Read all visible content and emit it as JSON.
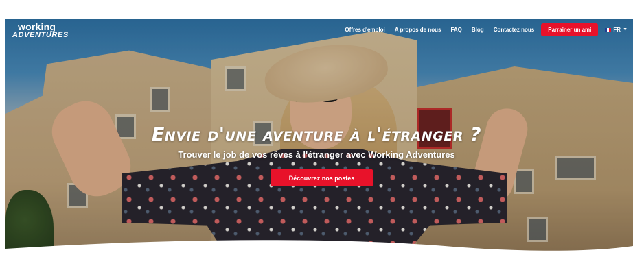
{
  "logo": {
    "line1": "working",
    "line2": "ADVENTURES"
  },
  "nav": {
    "items": [
      {
        "label": "Offres d'emploi"
      },
      {
        "label": "A propos de nous"
      },
      {
        "label": "FAQ"
      },
      {
        "label": "Blog"
      },
      {
        "label": "Contactez nous"
      }
    ],
    "refer_button": "Parrainer un ami",
    "language": "FR",
    "language_icon": "flag-fr-icon",
    "caret_icon": "chevron-down-icon"
  },
  "hero": {
    "headline": "Envie d'une aventure à l'étranger ?",
    "subline": "Trouver le job de vos rêves à l'étranger avec Working Adventures",
    "cta": "Découvrez nos postes"
  },
  "colors": {
    "accent": "#e8122a",
    "text_on_hero": "#ffffff"
  }
}
